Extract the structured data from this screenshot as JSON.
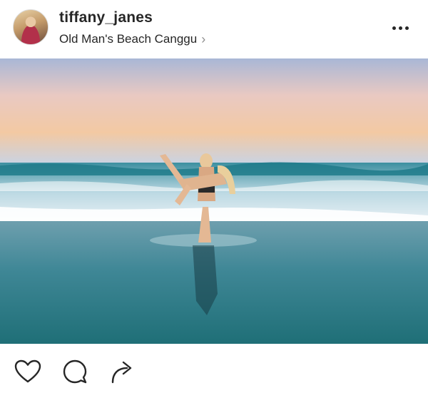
{
  "post": {
    "username": "tiffany_janes",
    "location": "Old Man's Beach Canggu",
    "location_chevron": "›"
  },
  "icons": {
    "avatar": "profile-photo",
    "more": "more-options-icon",
    "like": "heart-icon",
    "comment": "comment-bubble-icon",
    "share": "share-arrow-icon"
  },
  "colors": {
    "text": "#262626",
    "muted": "#8e8e8e",
    "background": "#ffffff"
  }
}
